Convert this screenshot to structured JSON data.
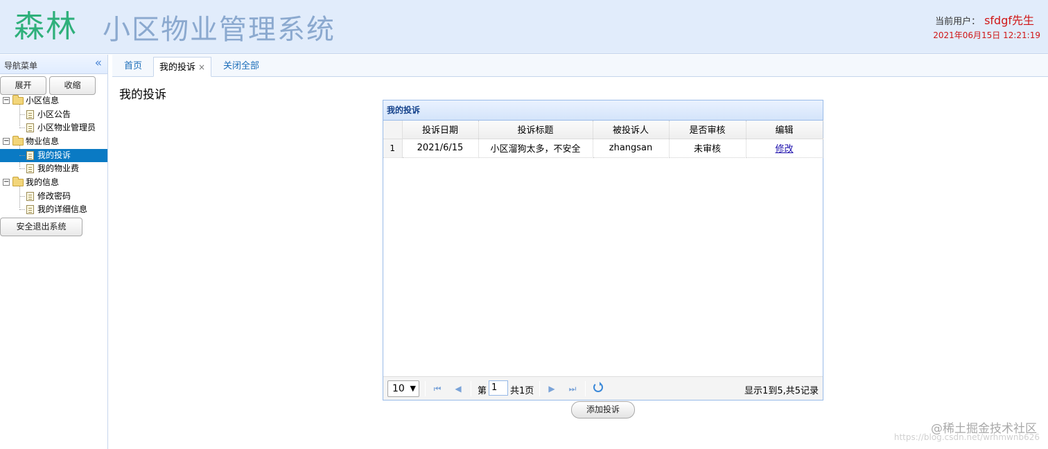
{
  "header": {
    "logo_text": "森林",
    "system_title": "小区物业管理系统",
    "current_user_label": "当前用户：",
    "current_user_name": "sfdgf先生",
    "datetime": "2021年06月15日 12:21:19"
  },
  "nav": {
    "title": "导航菜单",
    "expand_label": "展开",
    "collapse_label": "收缩",
    "groups": [
      {
        "label": "小区信息",
        "items": [
          "小区公告",
          "小区物业管理员"
        ]
      },
      {
        "label": "物业信息",
        "items": [
          "我的投诉",
          "我的物业费"
        ]
      },
      {
        "label": "我的信息",
        "items": [
          "修改密码",
          "我的详细信息"
        ]
      }
    ],
    "selected_item": "我的投诉",
    "logout_label": "安全退出系统"
  },
  "tabs": {
    "home": "首页",
    "active": "我的投诉",
    "close_all": "关闭全部",
    "close_glyph": "×"
  },
  "page": {
    "heading": "我的投诉"
  },
  "grid": {
    "title": "我的投诉",
    "columns": [
      "投诉日期",
      "投诉标题",
      "被投诉人",
      "是否审核",
      "编辑"
    ],
    "rows": [
      {
        "num": "1",
        "date": "2021/6/15",
        "title": "小区溜狗太多，不安全",
        "target": "zhangsan",
        "reviewed": "未审核",
        "edit": "修改"
      }
    ]
  },
  "pager": {
    "page_size": "10",
    "page_prefix": "第",
    "page_value": "1",
    "page_suffix": "共1页",
    "info": "显示1到5,共5记录"
  },
  "actions": {
    "add_complaint": "添加投诉"
  },
  "watermark": {
    "main": "@稀土掘金技术社区",
    "sub": "https://blog.csdn.net/wrhmwnb626"
  }
}
